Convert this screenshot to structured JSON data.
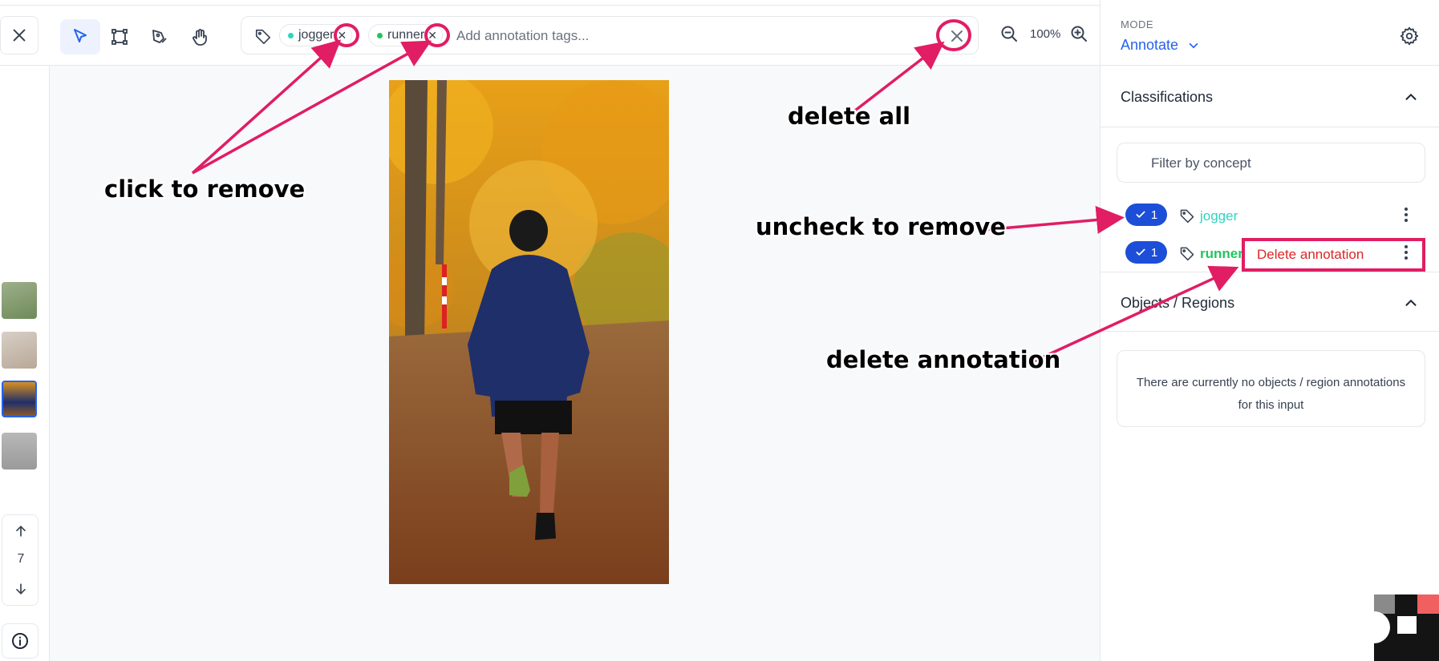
{
  "toolbar": {
    "close_icon": "close-icon",
    "tools": [
      "pointer-icon",
      "bounding-box-icon",
      "pen-icon",
      "hand-icon"
    ],
    "tag_icon": "tag-icon",
    "chips": [
      {
        "label": "jogger",
        "dot_color": "#2dd4bf"
      },
      {
        "label": "runner",
        "dot_color": "#22c55e"
      }
    ],
    "tag_placeholder": "Add annotation tags...",
    "zoom_level": "100%"
  },
  "header": {
    "mode_label": "MODE",
    "mode_value": "Annotate"
  },
  "classifications": {
    "title": "Classifications",
    "filter_placeholder": "Filter by concept",
    "items": [
      {
        "count": "1",
        "label": "jogger",
        "color": "#2dd4bf"
      },
      {
        "count": "1",
        "label": "runner",
        "color": "#22c55e"
      }
    ],
    "menu_item": "Delete annotation"
  },
  "objects": {
    "title": "Objects / Regions",
    "empty_line1": "There are currently no objects / region annotations",
    "empty_line2": "for this input"
  },
  "pager": {
    "page": "7"
  },
  "annotations": {
    "click_to_remove": "click to remove",
    "delete_all": "delete all",
    "uncheck_to_remove": "uncheck to remove",
    "delete_annotation": "delete annotation",
    "highlight_color": "#e11d63"
  },
  "colors": {
    "accent": "#2563eb",
    "pill": "#1d4ed8",
    "danger": "#dc2626"
  }
}
